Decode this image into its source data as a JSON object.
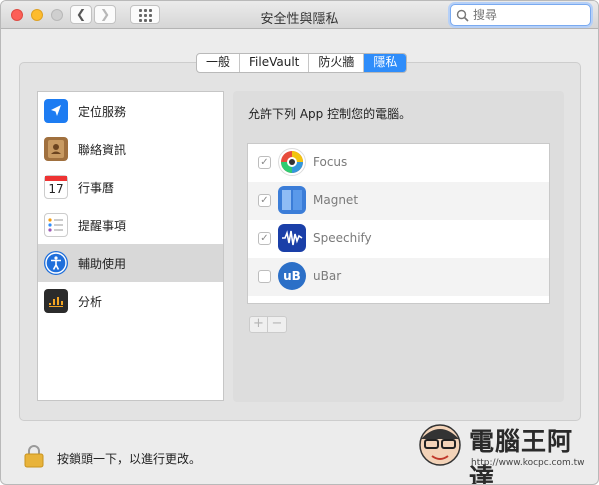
{
  "window": {
    "title": "安全性與隱私"
  },
  "search": {
    "placeholder": "搜尋"
  },
  "tabs": [
    {
      "label": "一般",
      "active": false
    },
    {
      "label": "FileVault",
      "active": false
    },
    {
      "label": "防火牆",
      "active": false
    },
    {
      "label": "隱私",
      "active": true
    }
  ],
  "sidebar": {
    "items": [
      {
        "label": "定位服務",
        "icon": "location-icon",
        "selected": false
      },
      {
        "label": "聯絡資訊",
        "icon": "contacts-icon",
        "selected": false
      },
      {
        "label": "行事曆",
        "icon": "calendar-icon",
        "selected": false,
        "calendar_day": "17"
      },
      {
        "label": "提醒事項",
        "icon": "reminders-icon",
        "selected": false
      },
      {
        "label": "輔助使用",
        "icon": "accessibility-icon",
        "selected": true
      },
      {
        "label": "分析",
        "icon": "analytics-icon",
        "selected": false
      }
    ]
  },
  "main": {
    "prompt": "允許下列 App 控制您的電腦。",
    "apps": [
      {
        "name": "Focus",
        "checked": true,
        "icon": "focus-app-icon"
      },
      {
        "name": "Magnet",
        "checked": true,
        "icon": "magnet-app-icon"
      },
      {
        "name": "Speechify",
        "checked": true,
        "icon": "speechify-app-icon"
      },
      {
        "name": "uBar",
        "checked": false,
        "icon": "ubar-app-icon",
        "icon_text": "uB"
      }
    ],
    "add_label": "+",
    "remove_label": "−"
  },
  "footer": {
    "lock_text": "按鎖頭一下，以進行更改。"
  },
  "watermark": {
    "title": "電腦王阿達",
    "url": "http://www.kocpc.com.tw"
  },
  "colors": {
    "accent": "#2f8dfa",
    "selected_row": "#d8d8d8"
  }
}
